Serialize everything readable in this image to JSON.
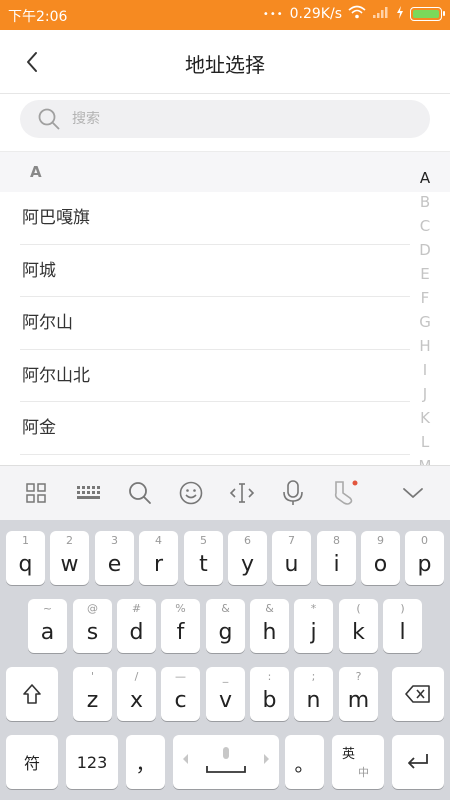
{
  "status_bar": {
    "time": "下午2:06",
    "speed": "0.29K/s",
    "dots": "•••"
  },
  "header": {
    "title": "地址选择",
    "back_icon": "chevron-left-icon"
  },
  "search": {
    "placeholder": "搜索"
  },
  "list": {
    "section": "A",
    "items": [
      "阿巴嘎旗",
      "阿城",
      "阿尔山",
      "阿尔山北",
      "阿金"
    ]
  },
  "index_bar": {
    "letters": [
      "A",
      "B",
      "C",
      "D",
      "E",
      "F",
      "G",
      "H",
      "I",
      "J",
      "K",
      "L",
      "M"
    ],
    "active": "A"
  },
  "toolbar": {
    "icons": [
      "grid-icon",
      "keyboard-icon",
      "search-icon",
      "emoji-icon",
      "cursor-icon",
      "microphone-icon",
      "sock-icon",
      "chevron-down-icon"
    ]
  },
  "keyboard": {
    "row1": [
      {
        "main": "q",
        "sub": "1"
      },
      {
        "main": "w",
        "sub": "2"
      },
      {
        "main": "e",
        "sub": "3"
      },
      {
        "main": "r",
        "sub": "4"
      },
      {
        "main": "t",
        "sub": "5"
      },
      {
        "main": "y",
        "sub": "6"
      },
      {
        "main": "u",
        "sub": "7"
      },
      {
        "main": "i",
        "sub": "8"
      },
      {
        "main": "o",
        "sub": "9"
      },
      {
        "main": "p",
        "sub": "0"
      }
    ],
    "row2": [
      {
        "main": "a",
        "sub": "~"
      },
      {
        "main": "s",
        "sub": "@"
      },
      {
        "main": "d",
        "sub": "#"
      },
      {
        "main": "f",
        "sub": "%"
      },
      {
        "main": "g",
        "sub": "&"
      },
      {
        "main": "h",
        "sub": "&"
      },
      {
        "main": "j",
        "sub": "*"
      },
      {
        "main": "k",
        "sub": "("
      },
      {
        "main": "l",
        "sub": ")"
      }
    ],
    "row3": [
      {
        "main": "z",
        "sub": "'"
      },
      {
        "main": "x",
        "sub": "/"
      },
      {
        "main": "c",
        "sub": "—"
      },
      {
        "main": "v",
        "sub": "_"
      },
      {
        "main": "b",
        "sub": ":"
      },
      {
        "main": "n",
        "sub": ";"
      },
      {
        "main": "m",
        "sub": "?"
      }
    ],
    "symbol_label": "符",
    "num_label": "123",
    "comma_label": "，",
    "period_label": "。",
    "lang_top": "英",
    "lang_bottom": "中"
  }
}
